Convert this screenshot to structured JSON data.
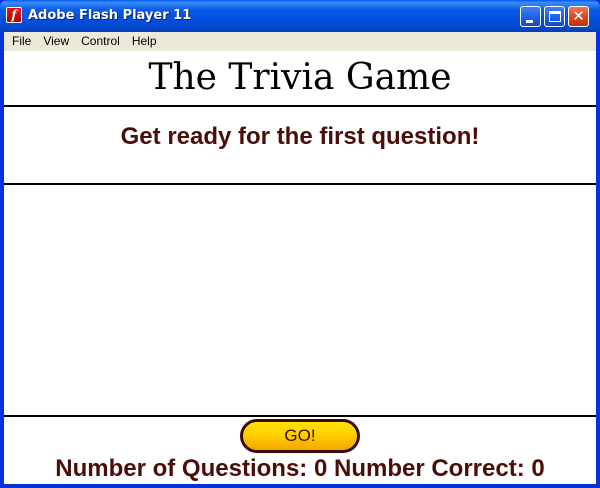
{
  "window": {
    "title": "Adobe Flash Player 11",
    "icon": "flash-f-icon",
    "icon_glyph": "f",
    "close_glyph": "✕"
  },
  "menu": {
    "items": [
      "File",
      "View",
      "Control",
      "Help"
    ]
  },
  "game": {
    "title": "The Trivia Game",
    "message": "Get ready for the first question!",
    "go_label": "GO!",
    "questions_label": "Number of Questions:",
    "questions_value": "0",
    "correct_label": "Number Correct:",
    "correct_value": "0"
  },
  "colors": {
    "text_dark_red": "#4a0e08",
    "button_yellow": "#ffd000",
    "titlebar_blue": "#0a5ce8"
  }
}
